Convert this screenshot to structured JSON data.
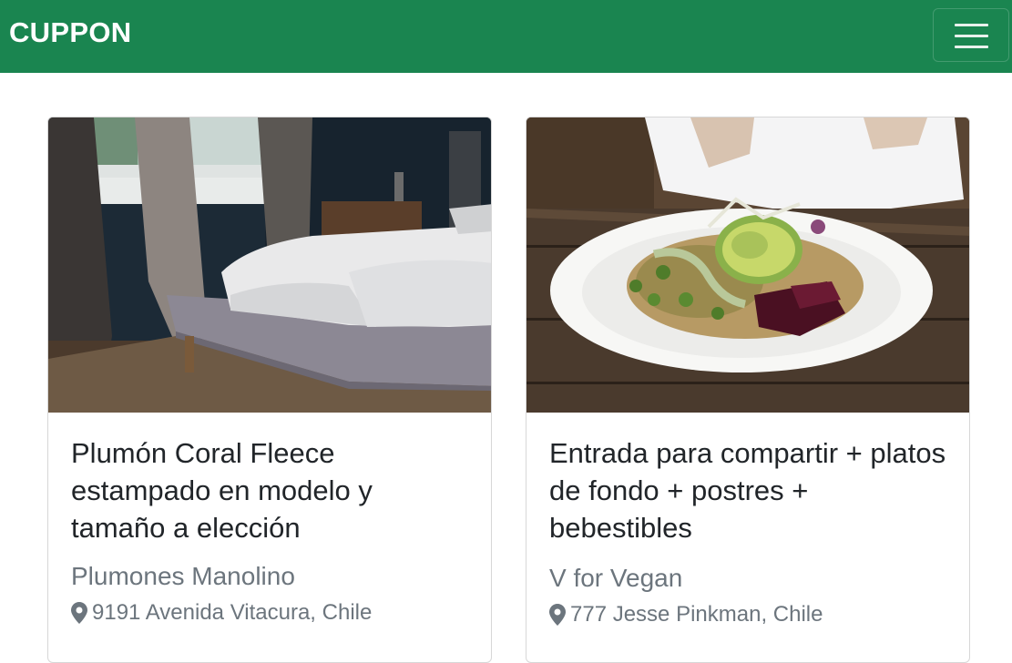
{
  "navbar": {
    "brand": "CUPPON",
    "menu_icon": "hamburger-menu-icon",
    "color": "#1a8550"
  },
  "cards": [
    {
      "image": "bedroom-bed-photo",
      "title": "Plumón Coral Fleece estampado en modelo y tamaño a elección",
      "merchant": "Plumones Manolino",
      "location_icon": "map-pin-icon",
      "location": "9191 Avenida Vitacura, Chile"
    },
    {
      "image": "vegan-salad-bowl-photo",
      "title": "Entrada para compartir + platos de fondo + postres + bebestibles",
      "merchant": "V for Vegan",
      "location_icon": "map-pin-icon",
      "location": "777 Jesse Pinkman, Chile"
    }
  ]
}
